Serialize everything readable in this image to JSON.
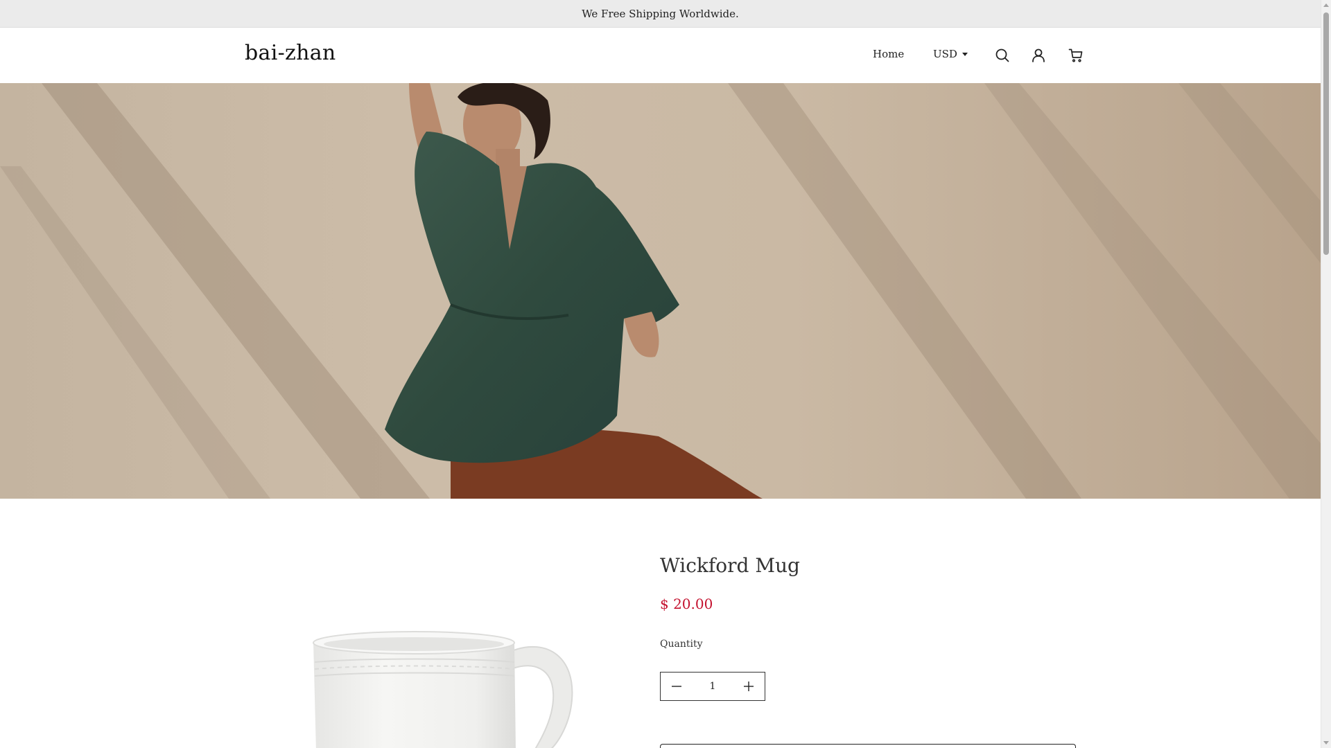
{
  "announcement": {
    "text": "We Free Shipping Worldwide."
  },
  "header": {
    "logo": "bai-zhan",
    "nav": {
      "home_label": "Home",
      "currency_label": "USD"
    },
    "icons": [
      "search-icon",
      "account-icon",
      "cart-icon"
    ]
  },
  "hero": {
    "image": "woman-in-green-blouse-photo"
  },
  "product": {
    "title": "Wickford Mug",
    "price": "$ 20.00",
    "quantity_label": "Quantity",
    "quantity_value": "1",
    "image": "white-mug-photo"
  },
  "colors": {
    "price": "#c4122f",
    "announcement_bg": "#ebebeb",
    "text": "#222222"
  }
}
